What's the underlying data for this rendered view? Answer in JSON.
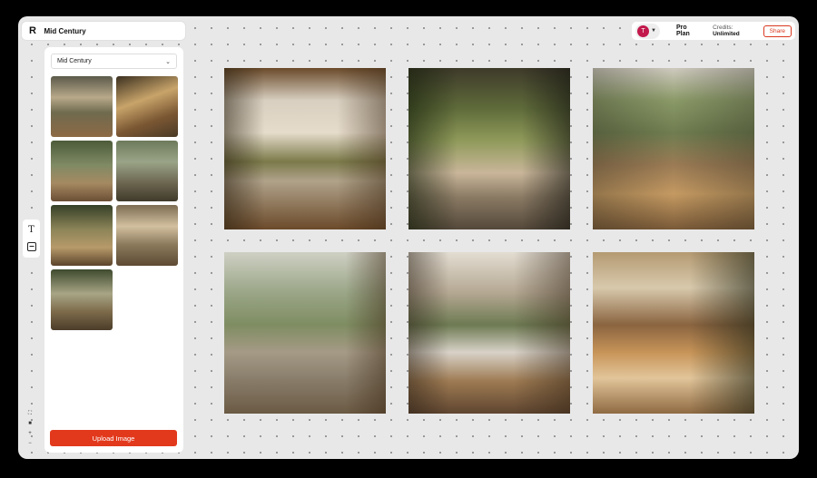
{
  "app": {
    "logo": "R",
    "project_title": "Mid Century"
  },
  "header": {
    "avatar_initial": "T",
    "plan": "Pro Plan",
    "credits_label": "Credits:",
    "credits_value": "Unlimited",
    "share_label": "Share"
  },
  "sidebar": {
    "style_select_value": "Mid Century",
    "upload_label": "Upload Image",
    "thumb_count": 7
  },
  "tools": {
    "text_icon": "T"
  },
  "gallery": {
    "image_count": 6
  },
  "colors": {
    "accent": "#e2391d",
    "avatar": "#c2184b"
  }
}
